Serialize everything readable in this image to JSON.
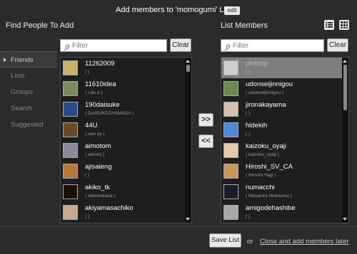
{
  "header": {
    "title": "Add members to 'momogumi' List",
    "edit_label": "edit"
  },
  "find": {
    "title": "Find People To Add",
    "filter_placeholder": "Filter",
    "clear_label": "Clear",
    "sidebar": [
      {
        "label": "Friends",
        "active": true
      },
      {
        "label": "Lists"
      },
      {
        "label": "Groups"
      },
      {
        "label": "Search"
      },
      {
        "label": "Suggested"
      }
    ],
    "people": [
      {
        "name": "11262009",
        "sub": "( )",
        "color": "#c9b16a"
      },
      {
        "name": "11610idea",
        "sub": "( i-de-a )",
        "color": "#7a8a5a"
      },
      {
        "name": "190daisuke",
        "sub": "( DAISUKEOYAMADA )",
        "color": "#2c4a8a"
      },
      {
        "name": "44U",
        "sub": "( uen oy )",
        "color": "#6a4a2a"
      },
      {
        "name": "aimotom",
        "sub": "( aimoto )",
        "color": "#8a8a9a"
      },
      {
        "name": "ajisaieng",
        "sub": "( )",
        "color": "#b8763a"
      },
      {
        "name": "akiko_tk",
        "sub": "( akikotakada )",
        "color": "#1a1208"
      },
      {
        "name": "akiyamasachiko",
        "sub": "( )",
        "color": "#c8a894"
      }
    ]
  },
  "members": {
    "title": "List Members",
    "filter_placeholder": "Filter",
    "clear_label": "Clear",
    "people": [
      {
        "name": "pinkhip",
        "sub": "( )",
        "color": "#cfcfcf",
        "selected": true
      },
      {
        "name": "udonseijinnigou",
        "sub": "( udonseijinnigou )",
        "color": "#6a8a4a"
      },
      {
        "name": "jironakayama",
        "sub": "( )",
        "color": "#d8c0b0"
      },
      {
        "name": "hidekih",
        "sub": "( )",
        "color": "#4a8ad8"
      },
      {
        "name": "kaizoku_oyaji",
        "sub": "( kaizoku_oyaji )",
        "color": "#e8c8a8"
      },
      {
        "name": "Hiroshi_SV_CA",
        "sub": "( Hiroshi Yagi )",
        "color": "#c89858"
      },
      {
        "name": "numacchi",
        "sub": "( Masahiro Hiranuma )",
        "color": "#1a1a2a"
      },
      {
        "name": "amigodehashibe",
        "sub": "( )",
        "color": "#a8a8a8"
      }
    ]
  },
  "actions": {
    "add_label": ">>",
    "remove_label": "<<",
    "save_label": "Save List",
    "or_label": "or",
    "close_label": "Close and add members later"
  }
}
